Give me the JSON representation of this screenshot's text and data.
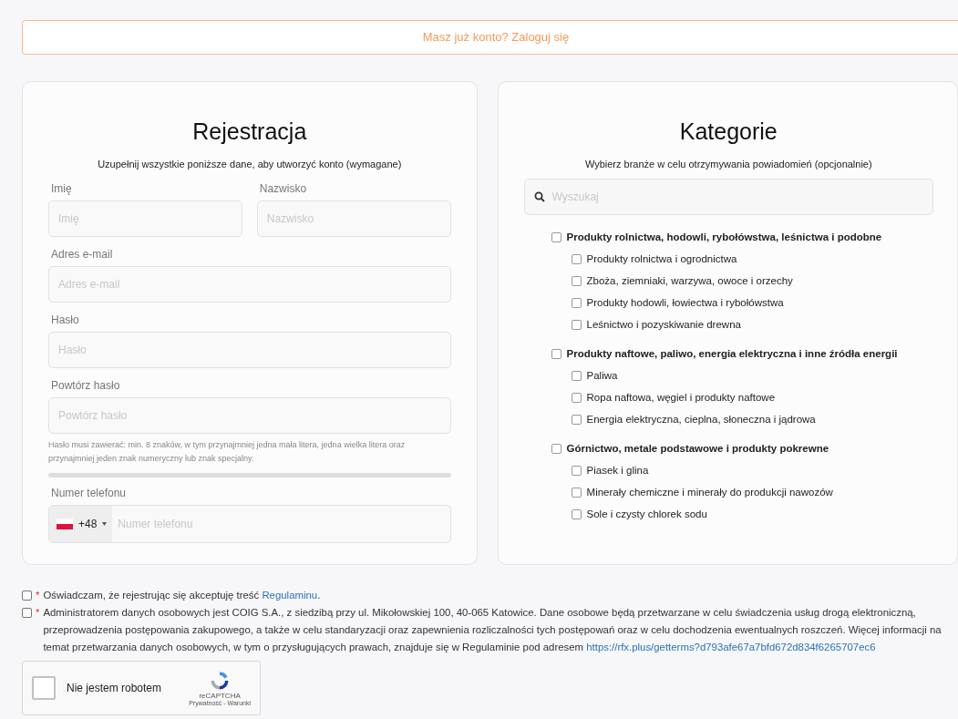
{
  "login_banner": {
    "text": "Masz już konto? Zaloguj się"
  },
  "registration": {
    "title": "Rejestracja",
    "subtitle": "Uzupełnij wszystkie poniższe dane, aby utworzyć konto (wymagane)",
    "name_fields": [
      {
        "label": "Imię",
        "placeholder": "Imię"
      },
      {
        "label": "Nazwisko",
        "placeholder": "Nazwisko"
      }
    ],
    "fields": [
      {
        "label": "Adres e-mail",
        "placeholder": "Adres e-mail"
      },
      {
        "label": "Hasło",
        "placeholder": "Hasło"
      },
      {
        "label": "Powtórz hasło",
        "placeholder": "Powtórz hasło"
      }
    ],
    "password_hint": "Hasło musi zawierać: min. 8 znaków, w tym przynajmniej jedna mała litera, jedna wielka litera oraz przynajmniej jeden znak numeryczny lub znak specjalny.",
    "phone": {
      "label": "Numer telefonu",
      "country_code": "+48",
      "placeholder": "Numer telefonu"
    }
  },
  "categories": {
    "title": "Kategorie",
    "subtitle": "Wybierz branże w celu otrzymywania powiadomień (opcjonalnie)",
    "search": {
      "placeholder": "Wyszukaj"
    },
    "groups": [
      {
        "label": "Produkty rolnictwa, hodowli, rybołówstwa, leśnictwa i podobne",
        "checked": false,
        "children": [
          {
            "label": "Produkty rolnictwa i ogrodnictwa",
            "checked": false
          },
          {
            "label": "Zboża, ziemniaki, warzywa, owoce i orzechy",
            "checked": false
          },
          {
            "label": "Produkty hodowli, łowiectwa i rybołówstwa",
            "checked": false
          },
          {
            "label": "Leśnictwo i pozyskiwanie drewna",
            "checked": false
          }
        ]
      },
      {
        "label": "Produkty naftowe, paliwo, energia elektryczna i inne źródła energii",
        "checked": false,
        "children": [
          {
            "label": "Paliwa",
            "checked": false
          },
          {
            "label": "Ropa naftowa, węgiel i produkty naftowe",
            "checked": false
          },
          {
            "label": "Energia elektryczna, cieplna, słoneczna i jądrowa",
            "checked": false
          }
        ]
      },
      {
        "label": "Górnictwo, metale podstawowe i produkty pokrewne",
        "checked": false,
        "children": [
          {
            "label": "Piasek i glina",
            "checked": false
          },
          {
            "label": "Minerały chemiczne i minerały do produkcji nawozów",
            "checked": false
          },
          {
            "label": "Sole i czysty chlorek sodu",
            "checked": false
          }
        ]
      }
    ]
  },
  "consents": [
    {
      "required_mark": "*",
      "text": "Oświadczam, że rejestrując się akceptuję treść",
      "link": "Regulaminu",
      "text_after": ".",
      "checked": false
    },
    {
      "required_mark": "*",
      "text": "Administratorem danych osobowych jest COIG S.A., z siedzibą przy ul. Mikołowskiej 100, 40-065 Katowice. Dane osobowe będą przetwarzane w celu świadczenia usług drogą elektroniczną, przeprowadzenia postępowania zakupowego, a także w celu standaryzacji oraz zapewnienia rozliczalności tych postępowań oraz w celu dochodzenia ewentualnych roszczeń. Więcej informacji na temat przetwarzania danych osobowych, w tym o przysługujących prawach, znajduje się w Regulaminie pod adresem",
      "link": "https://rfx.plus/getterms?d793afe67a7bfd672d834f6265707ec6",
      "checked": false
    }
  ],
  "captcha": {
    "label": "Nie jestem robotem",
    "checked": false,
    "brand": "reCAPTCHA",
    "links": "Prywatność - Warunki"
  }
}
